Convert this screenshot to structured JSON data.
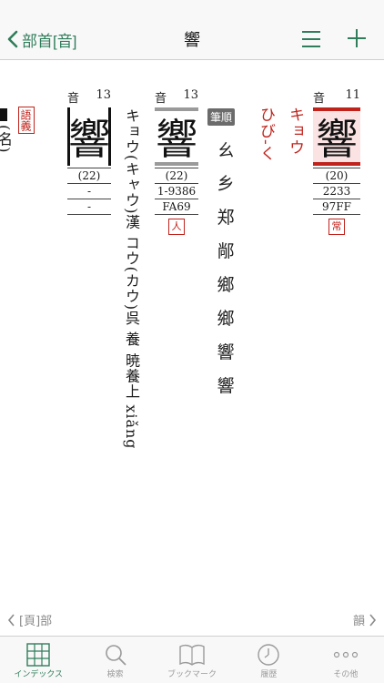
{
  "nav": {
    "back_label": "部首[音]",
    "title": "響"
  },
  "entries": {
    "main": {
      "radical": "音",
      "stroke_extra": "11",
      "kanji": "響",
      "strokes": "(20)",
      "jis": "2233",
      "unicode": "97FF",
      "badge": "常",
      "on_reading": "キョウ",
      "kun_reading": "ひび-く"
    },
    "variant1": {
      "radical": "音",
      "stroke_extra": "13",
      "kanji": "響",
      "strokes": "(22)",
      "jis": "1-9386",
      "unicode": "FA69",
      "badge": "人"
    },
    "variant2": {
      "radical": "音",
      "stroke_extra": "13",
      "kanji": "響",
      "strokes": "(22)",
      "line1": "-",
      "line2": "-"
    }
  },
  "stroke_order": {
    "label": "筆順",
    "steps": [
      "ㄠ",
      "乡",
      "郑",
      "䣊",
      "鄉",
      "鄉",
      "響",
      "響"
    ]
  },
  "readings": {
    "vertical_text": "キョウ(キャウ)漢 コウ(カウ)呉 養 暁養上 xiǎng"
  },
  "side": {
    "badge_text": "語義",
    "partial_text": "(名)"
  },
  "pager": {
    "prev": "[頁]部",
    "next": "韻"
  },
  "tabs": [
    {
      "label": "インデックス",
      "icon": "grid-icon"
    },
    {
      "label": "検索",
      "icon": "search-icon"
    },
    {
      "label": "ブックマーク",
      "icon": "book-icon"
    },
    {
      "label": "履歴",
      "icon": "clock-icon"
    },
    {
      "label": "その他",
      "icon": "more-icon"
    }
  ],
  "colors": {
    "accent": "#2f7d5a",
    "red": "#c0231c",
    "gray_bar": "#9a9a9a"
  }
}
